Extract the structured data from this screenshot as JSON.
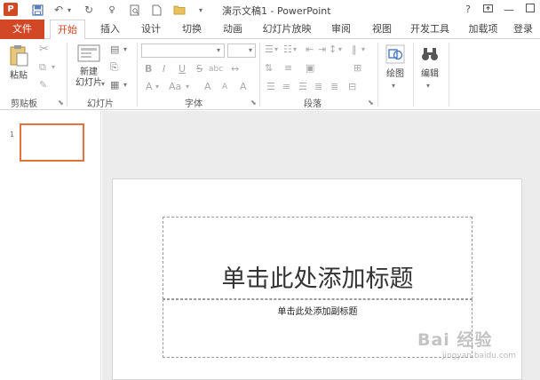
{
  "titlebar": {
    "title": "演示文稿1 - PowerPoint",
    "logo": "P",
    "help": "?"
  },
  "tabs": {
    "file": "文件",
    "home": "开始",
    "insert": "插入",
    "design": "设计",
    "transitions": "切换",
    "animations": "动画",
    "slideshow": "幻灯片放映",
    "review": "审阅",
    "view": "视图",
    "developer": "开发工具",
    "addins": "加载项",
    "signin": "登录"
  },
  "ribbon": {
    "paste": "粘贴",
    "new_slide_1": "新建",
    "new_slide_2": "幻灯片",
    "drawing": "绘图",
    "editing": "编辑",
    "groups": {
      "clipboard": "剪贴板",
      "slides": "幻灯片",
      "font": "字体",
      "paragraph": "段落"
    },
    "font_buttons": {
      "bold": "B",
      "italic": "I",
      "underline": "U",
      "strike": "S",
      "shadow": "abc",
      "font_color": "A",
      "change_case": "Aa",
      "grow": "A",
      "shrink": "A",
      "clear": "A"
    }
  },
  "thumbnails": {
    "slide_number": "1"
  },
  "slide": {
    "title_placeholder": "单击此处添加标题",
    "subtitle_placeholder": "单击此处添加副标题"
  },
  "watermark": {
    "text": "Bai 经验",
    "sub": "jingyan.baidu.com"
  }
}
